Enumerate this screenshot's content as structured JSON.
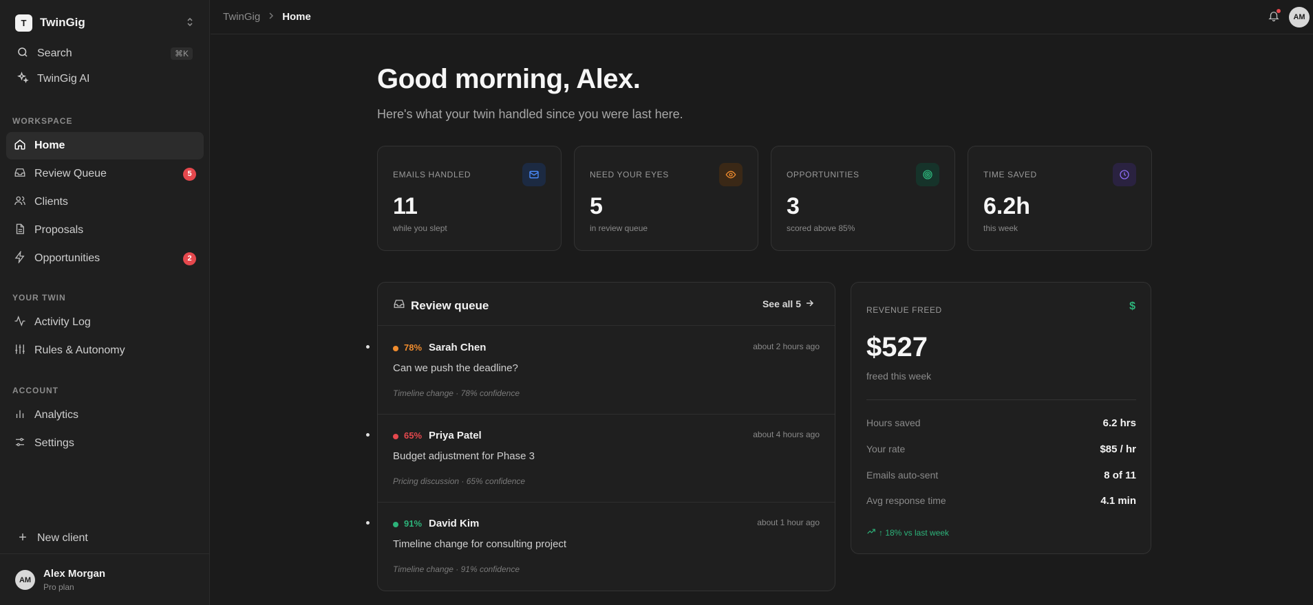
{
  "brand": {
    "initial": "T",
    "name": "TwinGig"
  },
  "search": {
    "label": "Search",
    "shortcut": "⌘K"
  },
  "ai": {
    "label": "TwinGig AI"
  },
  "sections": {
    "workspace": "WORKSPACE",
    "your_twin": "YOUR TWIN",
    "account": "ACCOUNT"
  },
  "nav": {
    "home": "Home",
    "review_queue": {
      "label": "Review Queue",
      "badge": "5"
    },
    "clients": "Clients",
    "proposals": "Proposals",
    "opportunities": {
      "label": "Opportunities",
      "badge": "2"
    },
    "activity_log": "Activity Log",
    "rules": "Rules & Autonomy",
    "analytics": "Analytics",
    "settings": "Settings"
  },
  "new_client": "New client",
  "user": {
    "initials": "AM",
    "name": "Alex Morgan",
    "plan": "Pro plan"
  },
  "breadcrumb": {
    "root": "TwinGig",
    "current": "Home"
  },
  "greeting": "Good morning, Alex.",
  "subtitle": "Here's what your twin handled since you were last here.",
  "stats": [
    {
      "label": "EMAILS HANDLED",
      "value": "11",
      "sub": "while you slept",
      "icon": "mail-icon",
      "color": "#4c8dff"
    },
    {
      "label": "NEED YOUR EYES",
      "value": "5",
      "sub": "in review queue",
      "icon": "eye-icon",
      "color": "#f08c2e"
    },
    {
      "label": "OPPORTUNITIES",
      "value": "3",
      "sub": "scored above 85%",
      "icon": "target-icon",
      "color": "#2db37a"
    },
    {
      "label": "TIME SAVED",
      "value": "6.2h",
      "sub": "this week",
      "icon": "clock-icon",
      "color": "#8b6cf0"
    }
  ],
  "queue": {
    "title": "Review queue",
    "see_all": "See all 5",
    "items": [
      {
        "pct": "78%",
        "name": "Sarah Chen",
        "time": "about 2 hours ago",
        "subject": "Can we push the deadline?",
        "meta": "Timeline change · 78% confidence",
        "color": "#f08c2e"
      },
      {
        "pct": "65%",
        "name": "Priya Patel",
        "time": "about 4 hours ago",
        "subject": "Budget adjustment for Phase 3",
        "meta": "Pricing discussion · 65% confidence",
        "color": "#e5484d"
      },
      {
        "pct": "91%",
        "name": "David Kim",
        "time": "about 1 hour ago",
        "subject": "Timeline change for consulting project",
        "meta": "Timeline change · 91% confidence",
        "color": "#2db37a"
      }
    ]
  },
  "revenue": {
    "label": "REVENUE FREED",
    "amount": "$527",
    "sub": "freed this week",
    "rows": [
      {
        "k": "Hours saved",
        "v": "6.2 hrs"
      },
      {
        "k": "Your rate",
        "v": "$85 / hr"
      },
      {
        "k": "Emails auto-sent",
        "v": "8 of 11"
      },
      {
        "k": "Avg response time",
        "v": "4.1 min"
      }
    ],
    "trend": "↑ 18% vs last week"
  },
  "colors": {
    "accent_red": "#e5484d",
    "accent_green": "#2db37a",
    "background": "#1b1b1b"
  }
}
